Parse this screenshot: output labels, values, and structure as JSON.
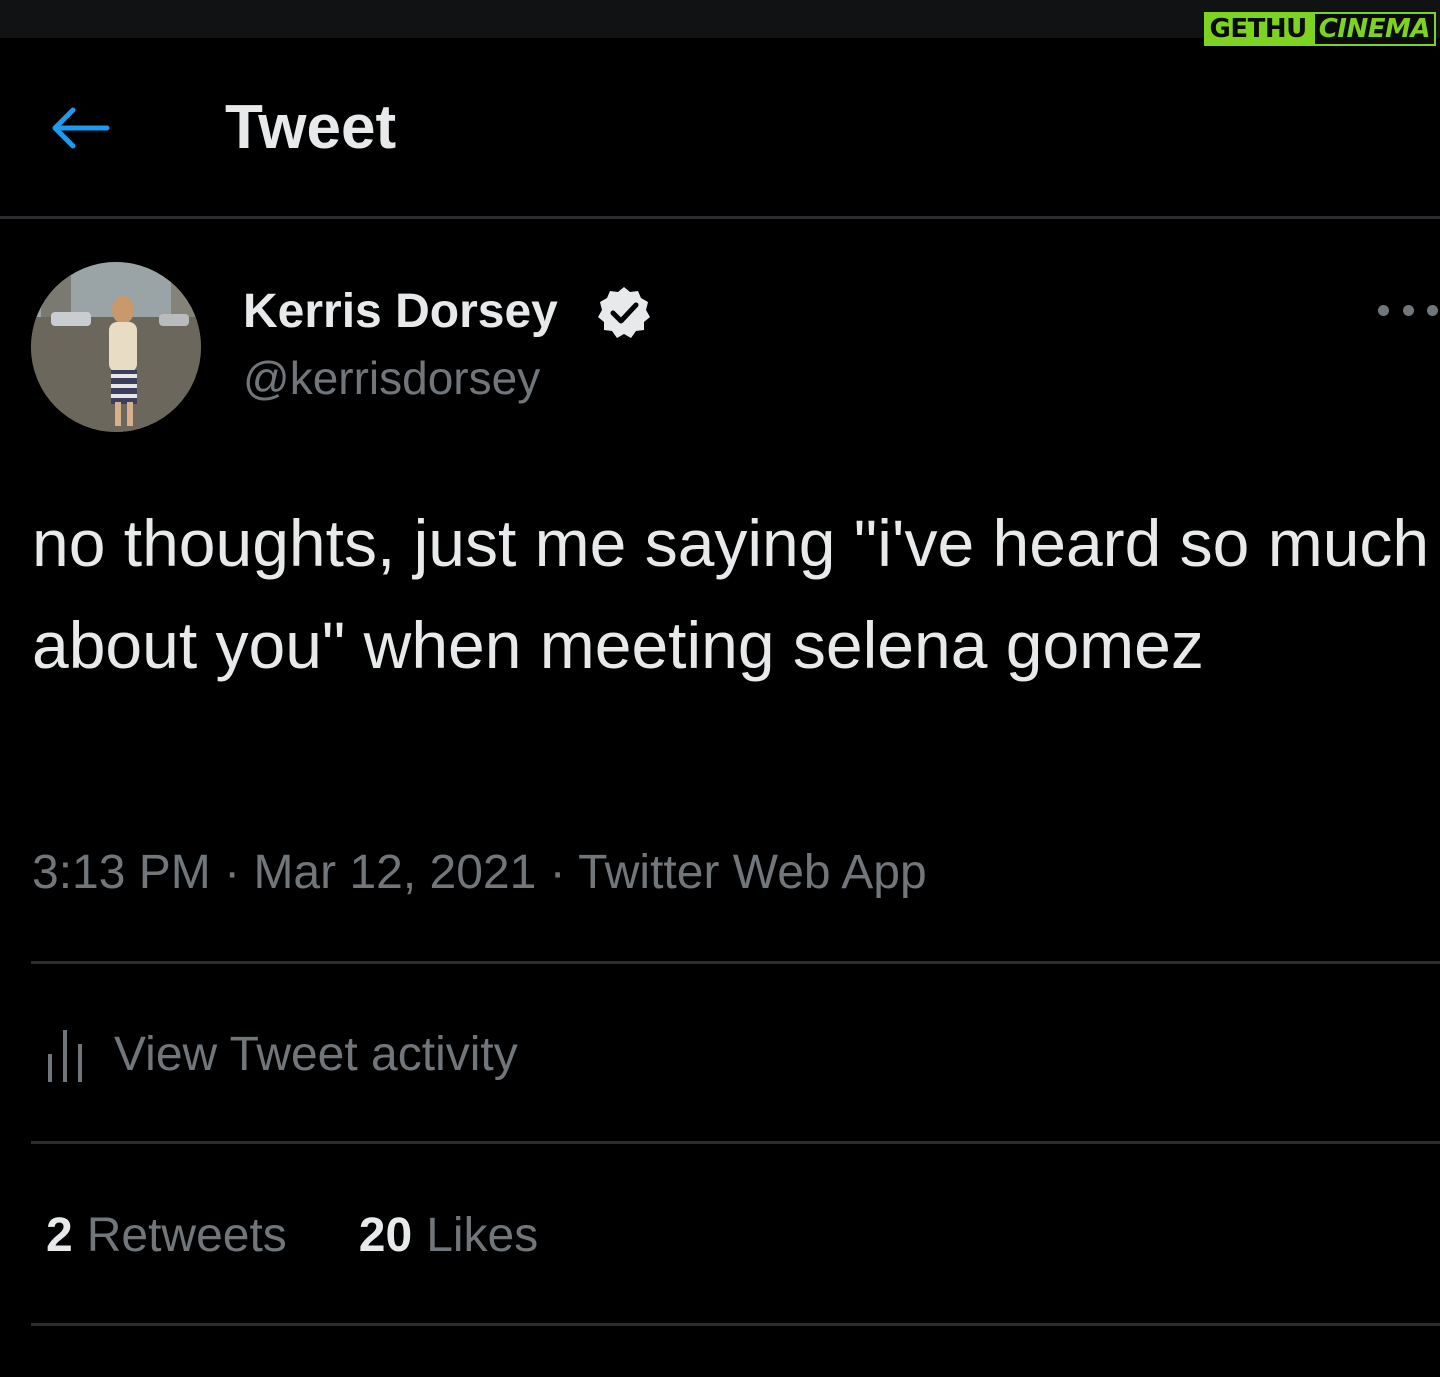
{
  "watermark": {
    "part_a": "GETHU",
    "part_b": "CINEMA"
  },
  "header": {
    "title": "Tweet",
    "back_icon": "arrow-left-icon"
  },
  "tweet": {
    "display_name": "Kerris Dorsey",
    "handle": "@kerrisdorsey",
    "verified": true,
    "text": "no thoughts, just me saying \"i've heard so much about you\" when meeting selena gomez",
    "time": "3:13 PM",
    "date": "Mar 12, 2021",
    "source": "Twitter Web App",
    "separator": "·"
  },
  "activity": {
    "label": "View Tweet activity",
    "icon": "bar-chart-icon"
  },
  "stats": {
    "retweets_count": "2",
    "retweets_label": "Retweets",
    "likes_count": "20",
    "likes_label": "Likes"
  },
  "colors": {
    "background": "#000000",
    "text_primary": "#e7e9ea",
    "text_secondary": "#71767b",
    "accent": "#1d9bf0",
    "divider": "#2a2d30",
    "watermark_green": "#7ed321"
  }
}
